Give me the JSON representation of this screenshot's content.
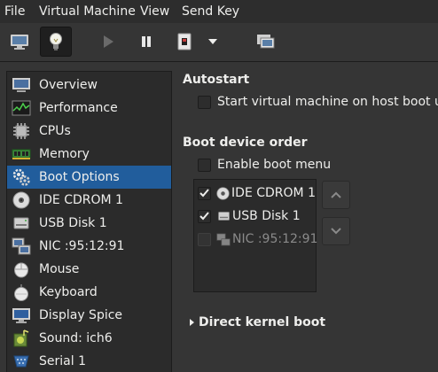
{
  "menubar": {
    "items": [
      "File",
      "Virtual Machine",
      "View",
      "Send Key"
    ]
  },
  "toolbar": {
    "buttons": [
      {
        "icon": "monitor-icon",
        "active": false
      },
      {
        "icon": "lightbulb-icon",
        "active": true
      },
      {
        "icon": "play-icon",
        "active": false
      },
      {
        "icon": "pause-icon",
        "active": false
      },
      {
        "icon": "shutdown-icon",
        "active": false
      },
      {
        "icon": "dropdown-arrow-icon",
        "active": false
      },
      {
        "icon": "snapshot-icon",
        "active": false
      }
    ]
  },
  "sidebar": {
    "items": [
      {
        "label": "Overview",
        "icon": "overview-icon",
        "selected": false
      },
      {
        "label": "Performance",
        "icon": "performance-icon",
        "selected": false
      },
      {
        "label": "CPUs",
        "icon": "cpu-icon",
        "selected": false
      },
      {
        "label": "Memory",
        "icon": "memory-icon",
        "selected": false
      },
      {
        "label": "Boot Options",
        "icon": "boot-options-icon",
        "selected": true
      },
      {
        "label": "IDE CDROM 1",
        "icon": "cdrom-icon",
        "selected": false
      },
      {
        "label": "USB Disk 1",
        "icon": "usb-disk-icon",
        "selected": false
      },
      {
        "label": "NIC :95:12:91",
        "icon": "nic-icon",
        "selected": false
      },
      {
        "label": "Mouse",
        "icon": "mouse-icon",
        "selected": false
      },
      {
        "label": "Keyboard",
        "icon": "keyboard-icon",
        "selected": false
      },
      {
        "label": "Display Spice",
        "icon": "display-icon",
        "selected": false
      },
      {
        "label": "Sound: ich6",
        "icon": "sound-icon",
        "selected": false
      },
      {
        "label": "Serial 1",
        "icon": "serial-icon",
        "selected": false
      }
    ]
  },
  "autostart": {
    "title": "Autostart",
    "checkbox_label": "Start virtual machine on host boot up",
    "checked": false
  },
  "boot_order": {
    "title": "Boot device order",
    "enable_menu_label": "Enable boot menu",
    "enable_menu_checked": false,
    "devices": [
      {
        "label": "IDE CDROM 1",
        "icon": "cdrom-icon",
        "checked": true,
        "enabled": true
      },
      {
        "label": "USB Disk 1",
        "icon": "usb-disk-icon",
        "checked": true,
        "enabled": true
      },
      {
        "label": "NIC :95:12:91",
        "icon": "nic-icon",
        "checked": false,
        "enabled": false
      }
    ]
  },
  "kernel_boot": {
    "label": "Direct kernel boot",
    "expanded": false
  },
  "colors": {
    "background": "#353535",
    "selection": "#215d9c",
    "text": "#eeeeec",
    "disabled_text": "#8a8a8a"
  }
}
